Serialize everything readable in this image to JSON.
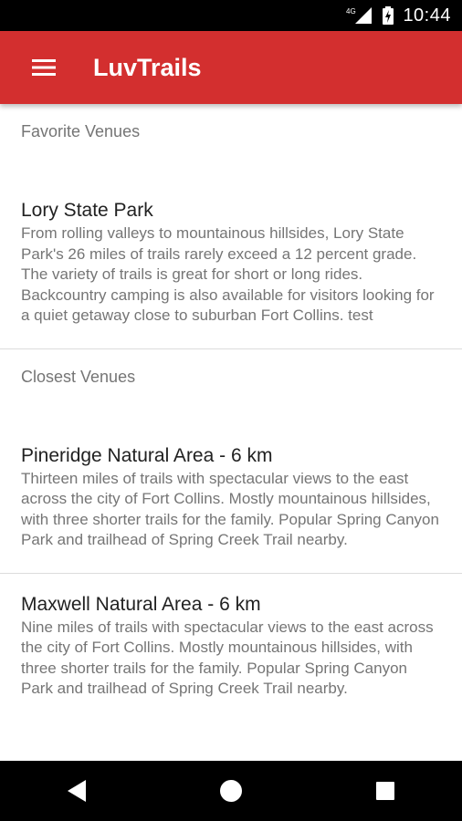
{
  "status_bar": {
    "network": "4G",
    "time": "10:44"
  },
  "app_bar": {
    "title": "LuvTrails",
    "color": "#d32f2f"
  },
  "favorites": {
    "header": "Favorite Venues",
    "items": [
      {
        "title": "Lory State Park",
        "description": "From rolling valleys to mountainous hillsides, Lory State Park's 26 miles of trails rarely exceed a 12 percent grade. The variety of trails is great for short or long rides. Backcountry camping is also available for visitors looking for a quiet getaway close to suburban Fort Collins. test"
      }
    ]
  },
  "closest": {
    "header": "Closest Venues",
    "items": [
      {
        "title": "Pineridge Natural Area - 6 km",
        "description": "Thirteen miles of trails with spectacular views to the east across the city of Fort Collins. Mostly mountainous hillsides, with three shorter trails for the family. Popular Spring Canyon Park and trailhead of Spring Creek Trail nearby."
      },
      {
        "title": "Maxwell Natural Area - 6 km",
        "description": "Nine miles of trails with spectacular views to the east across the city of Fort Collins. Mostly mountainous hillsides, with three shorter trails for the family. Popular Spring Canyon Park and trailhead of Spring Creek Trail nearby."
      }
    ]
  },
  "icons": {
    "menu": "hamburger-menu-icon",
    "signal": "cellular-signal-icon",
    "battery": "battery-charging-icon",
    "back": "back-triangle-icon",
    "home": "home-circle-icon",
    "recents": "recents-square-icon"
  }
}
